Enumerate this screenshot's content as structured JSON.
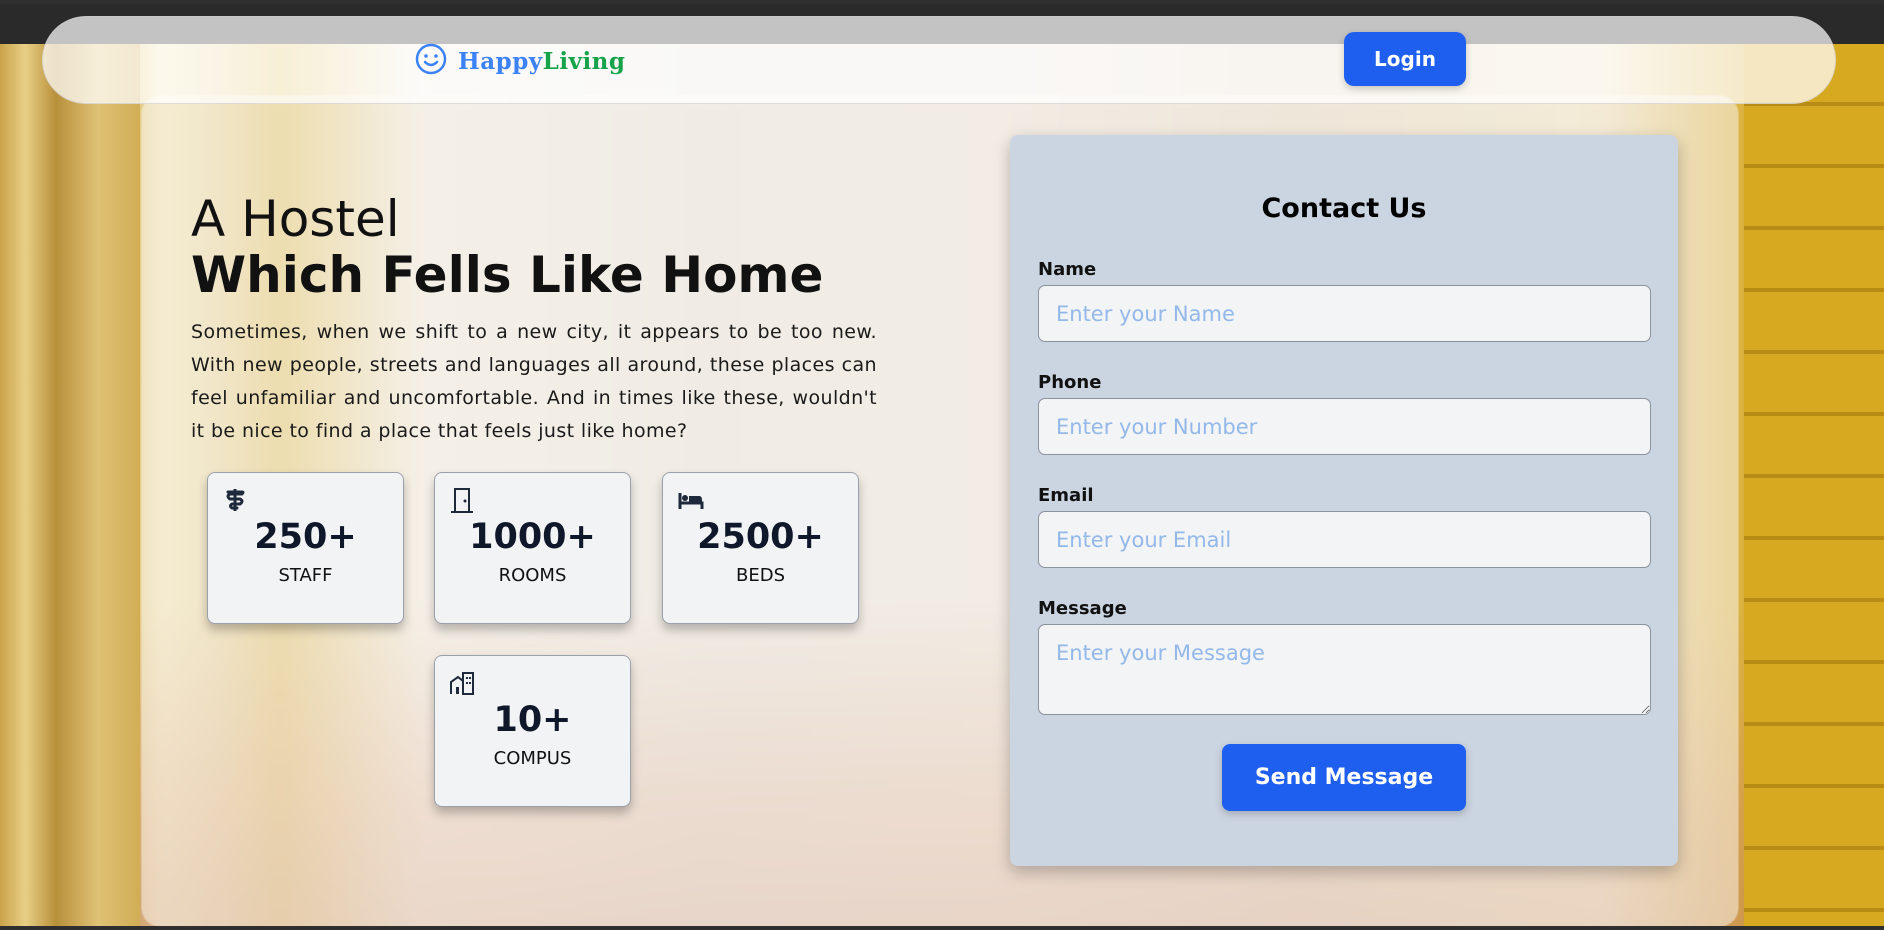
{
  "brand": {
    "part1": "Happy",
    "part2": "Living",
    "icon": "smiley-icon"
  },
  "nav": {
    "login_label": "Login"
  },
  "hero": {
    "title_line1": "A Hostel",
    "title_line2": "Which Fells Like Home",
    "description": "Sometimes, when we shift to a new city, it appears to be too new. With new people, streets and languages all around, these places can feel unfamiliar and uncomfortable. And in times like these, wouldn't it be nice to find a place that feels just like home?"
  },
  "stats": [
    {
      "icon": "staff-caduceus-icon",
      "value": "250+",
      "label": "STAFF"
    },
    {
      "icon": "door-icon",
      "value": "1000+",
      "label": "ROOMS"
    },
    {
      "icon": "bed-icon",
      "value": "2500+",
      "label": "BEDS"
    },
    {
      "icon": "building-icon",
      "value": "10+",
      "label": "COMPUS"
    }
  ],
  "contact": {
    "title": "Contact Us",
    "name_label": "Name",
    "name_placeholder": "Enter your Name",
    "phone_label": "Phone",
    "phone_placeholder": "Enter your Number",
    "email_label": "Email",
    "email_placeholder": "Enter your Email",
    "message_label": "Message",
    "message_placeholder": "Enter your Message",
    "send_label": "Send Message"
  },
  "colors": {
    "accent": "#1f5ff0",
    "brand_blue": "#3b82f6",
    "brand_green": "#16a34a",
    "card_bg": "#cbd4e1"
  }
}
